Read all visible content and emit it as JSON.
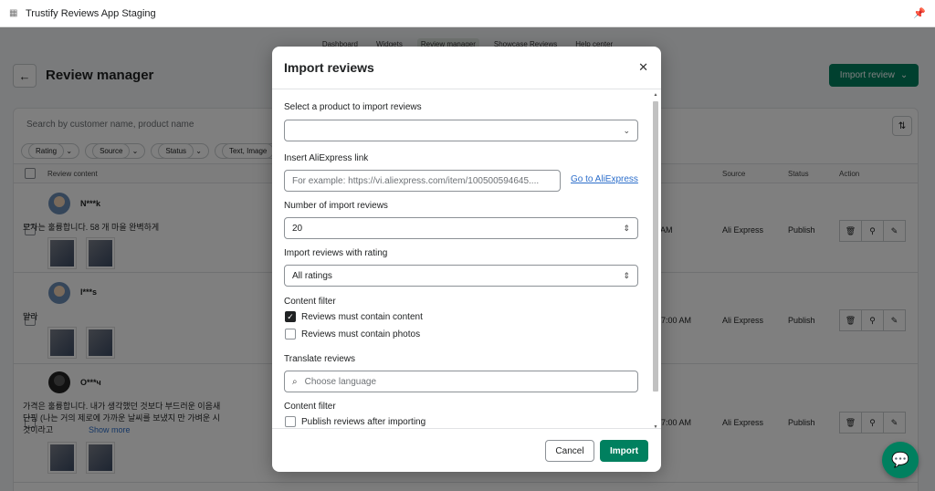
{
  "app": {
    "title": "Trustify Reviews App Staging"
  },
  "nav": {
    "tabs": [
      "Dashboard",
      "Widgets",
      "Review manager",
      "Showcase Reviews",
      "Help center"
    ],
    "active": "Review manager"
  },
  "page": {
    "title": "Review manager",
    "import_button": "Import review"
  },
  "list": {
    "search_placeholder": "Search by customer name, product name",
    "filters": [
      "Rating",
      "Source",
      "Status",
      "Text, Image"
    ],
    "columns": {
      "content": "Review content",
      "source": "Source",
      "status": "Status",
      "action": "Action"
    },
    "rows": [
      {
        "name": "N***k",
        "text": "모자는 훌륭합니다. 58 개 마을 완벽하게",
        "date": "AM",
        "source": "Ali Express",
        "status": "Publish"
      },
      {
        "name": "l***s",
        "text": "말라",
        "date": "t 7:00 AM",
        "source": "Ali Express",
        "status": "Publish"
      },
      {
        "name": "O***ч",
        "text": "가격은 훌륭합니다. 내가 생각했던 것보다 부드러운 이음새",
        "text2": "단핑 (나는 거의 제로에 가까운 날씨를 보냈지 만 가벼운 시",
        "text3": "것이라고",
        "show_more": "Show more",
        "date": "t 7:00 AM",
        "source": "Ali Express",
        "status": "Publish"
      }
    ]
  },
  "modal": {
    "title": "Import reviews",
    "product_label": "Select a product to import reviews",
    "product_value": "",
    "ali_label": "Insert AliExpress link",
    "ali_placeholder": "For example: https://vi.aliexpress.com/item/100500594645....",
    "ali_link": "Go to AliExpress",
    "count_label": "Number of import reviews",
    "count_value": "20",
    "rating_label": "Import reviews with rating",
    "rating_value": "All ratings",
    "content_filter_label": "Content filter",
    "must_content": "Reviews must contain content",
    "must_photos": "Reviews must contain photos",
    "translate_label": "Translate reviews",
    "language_placeholder": "Choose language",
    "content_filter_label_2": "Content filter",
    "publish_after": "Publish reviews after importing",
    "cancel": "Cancel",
    "submit": "Import"
  },
  "icons": {
    "close": "close-icon",
    "chevron": "chevron-down-icon",
    "updown": "chevron-updown-icon",
    "search": "search-icon",
    "chat": "chat-icon",
    "pin": "pin-icon"
  },
  "colors": {
    "primary": "#00805f",
    "link": "#2c6ecb"
  }
}
